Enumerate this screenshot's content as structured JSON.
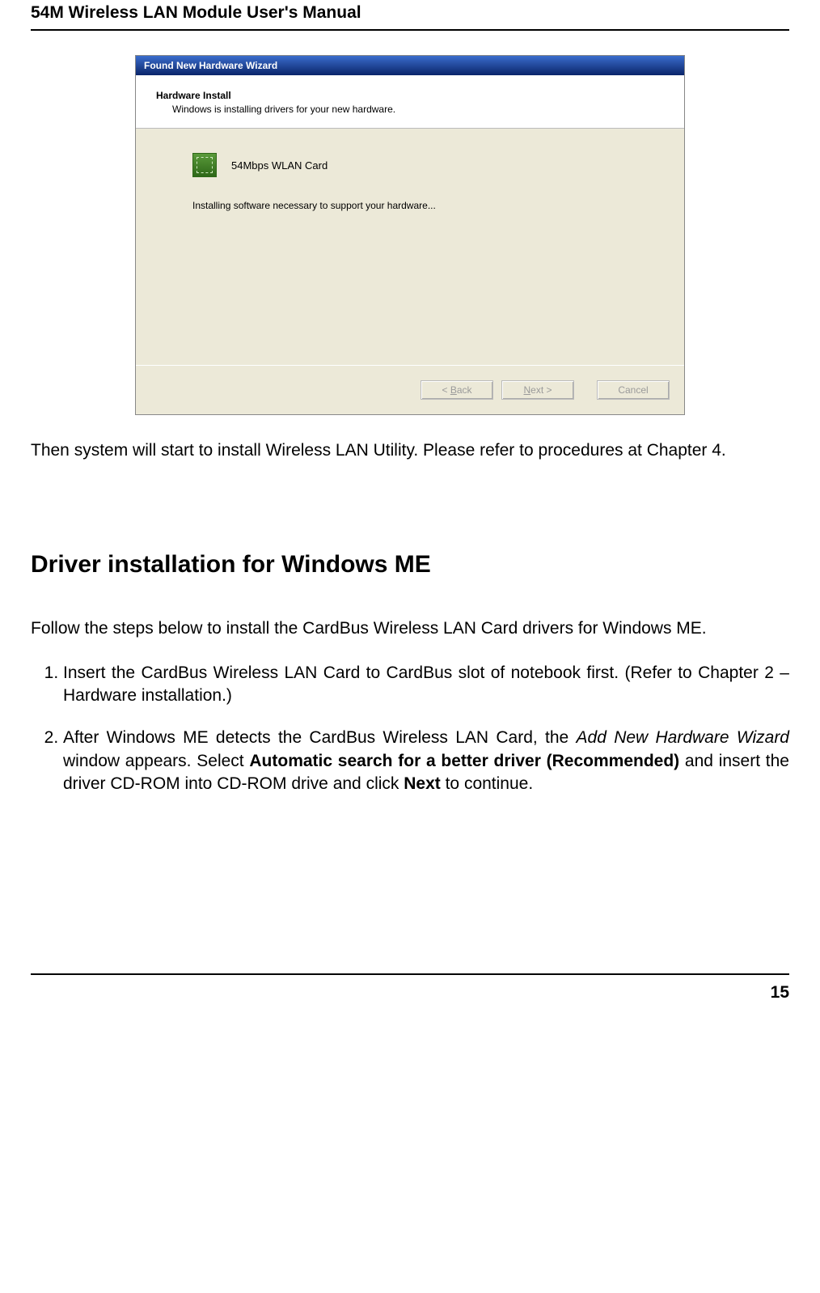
{
  "header": {
    "title": "54M Wireless LAN Module User's Manual"
  },
  "wizard": {
    "title": "Found New Hardware Wizard",
    "hw_install_label": "Hardware Install",
    "subtext": "Windows is installing drivers for your new hardware.",
    "device_name": "54Mbps WLAN Card",
    "status_text": "Installing software necessary to support your hardware...",
    "back_btn": "< Back",
    "next_btn": "Next >",
    "cancel_btn": "Cancel"
  },
  "paragraph1": "Then system will start to install Wireless LAN Utility. Please refer to procedures at Chapter 4.",
  "section_heading": "Driver installation for Windows ME",
  "section_desc": "Follow the steps below to install the CardBus Wireless LAN Card drivers for Windows ME.",
  "step1": "Insert the CardBus Wireless LAN Card to CardBus slot of notebook first. (Refer to Chapter 2 – Hardware installation.)",
  "step2": {
    "pre": "After Windows ME detects the CardBus Wireless LAN Card, the ",
    "italic1": "Add New Hardware Wizard",
    "mid1": " window appears. Select ",
    "bold1": "Automatic search for a better driver (Recommended)",
    "mid2": " and insert the driver CD-ROM into CD-ROM drive and click ",
    "bold2": "Next",
    "post": " to continue."
  },
  "page_number": "15"
}
